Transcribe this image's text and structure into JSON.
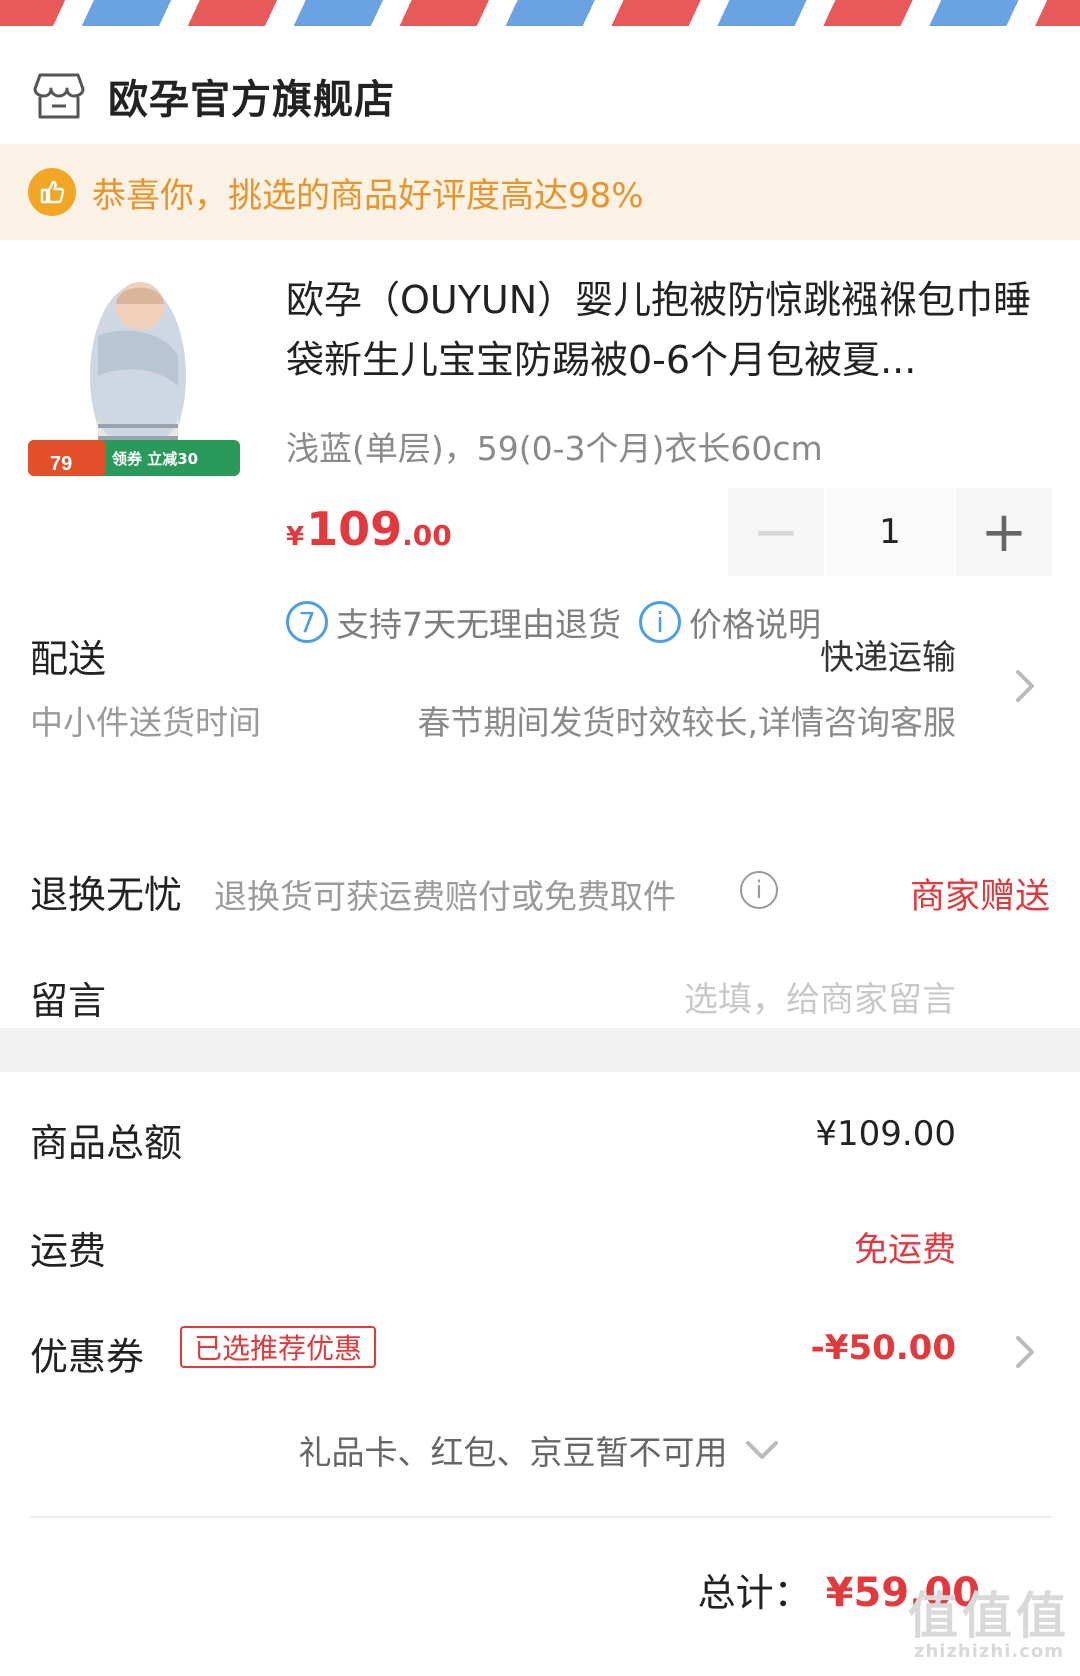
{
  "shop": {
    "name": "欧孕官方旗舰店",
    "icon": "store-icon"
  },
  "banner": {
    "text": "恭喜你，挑选的商品好评度高达98%",
    "icon": "thumbs-up-icon"
  },
  "product": {
    "image_badge_price": "79",
    "image_badge_text": "领券 立减30",
    "title": "欧孕（OUYUN）婴儿抱被防惊跳襁褓包巾睡袋新生儿宝宝防踢被0-6个月包被夏...",
    "spec": "浅蓝(单层)，59(0-3个月)衣长60cm",
    "price_currency": "¥",
    "price_int": "109",
    "price_dec": ".00",
    "quantity": "1",
    "minus_label": "−",
    "plus_label": "+"
  },
  "services": {
    "return_badge": "7",
    "return_text": "支持7天无理由退货",
    "info_badge": "i",
    "price_note": "价格说明"
  },
  "delivery": {
    "label": "配送",
    "method": "快递运输",
    "sub_label": "中小件送货时间",
    "sub_value": "春节期间发货时效较长,详情咨询客服"
  },
  "returns": {
    "label": "退换无忧",
    "desc": "退换货可获运费赔付或免费取件",
    "info_badge": "i",
    "value": "商家赠送"
  },
  "message": {
    "label": "留言",
    "placeholder": "选填，给商家留言"
  },
  "summary": {
    "goods_label": "商品总额",
    "goods_value": "¥109.00",
    "shipping_label": "运费",
    "shipping_value": "免运费",
    "coupon_label": "优惠券",
    "coupon_tag": "已选推荐优惠",
    "coupon_value": "-¥50.00",
    "giftcard_text": "礼品卡、红包、京豆暂不可用",
    "total_label": "总计：",
    "total_value": "¥59.00"
  },
  "watermark": {
    "main": "值值值",
    "sub": "zhizhizhi.com"
  },
  "colors": {
    "accent_red": "#e4393c",
    "banner_bg": "#fbf2e6",
    "banner_text": "#e9942a",
    "service_blue": "#4c9ee8"
  }
}
